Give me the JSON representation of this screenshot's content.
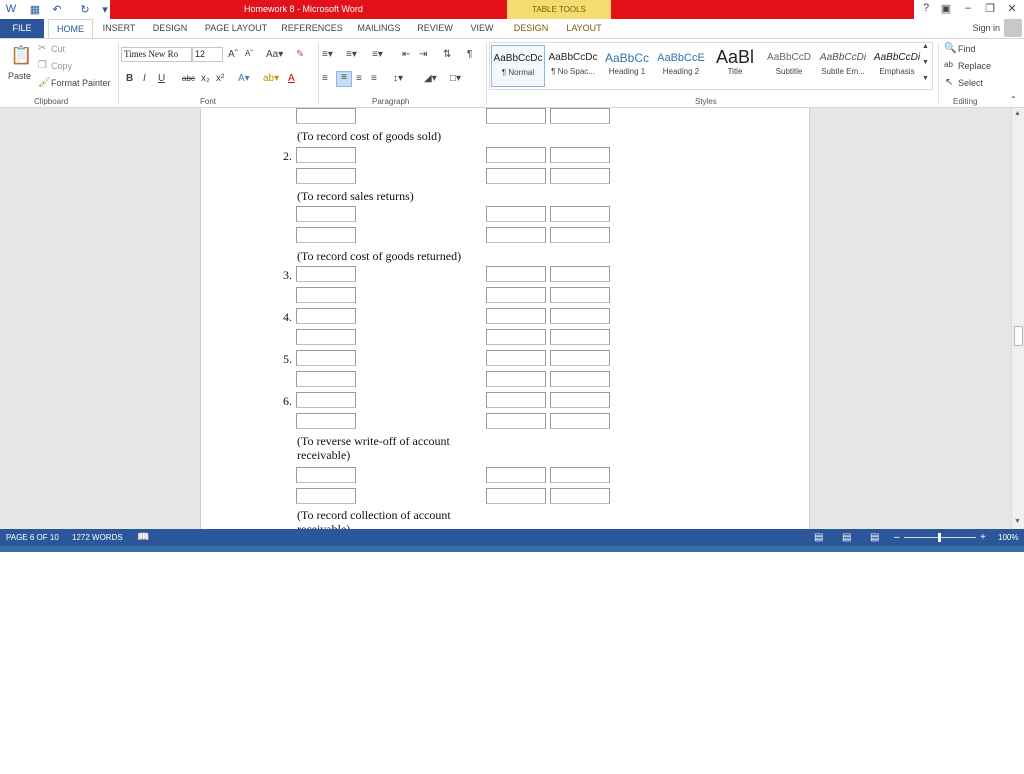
{
  "window": {
    "title": "Homework 8 - Microsoft Word",
    "table_tools": "TABLE TOOLS"
  },
  "tabs": [
    "FILE",
    "HOME",
    "INSERT",
    "DESIGN",
    "PAGE LAYOUT",
    "REFERENCES",
    "MAILINGS",
    "REVIEW",
    "VIEW",
    "DESIGN",
    "LAYOUT"
  ],
  "account": {
    "sign_in": "Sign in"
  },
  "ribbon": {
    "clipboard": {
      "label": "Clipboard",
      "paste": "Paste",
      "cut": "Cut",
      "copy": "Copy",
      "format_painter": "Format Painter"
    },
    "font": {
      "label": "Font",
      "family": "Times New Ro",
      "size": "12"
    },
    "paragraph": {
      "label": "Paragraph"
    },
    "styles": {
      "label": "Styles",
      "items": [
        {
          "preview": "AaBbCcDc",
          "name": "¶ Normal"
        },
        {
          "preview": "AaBbCcDc",
          "name": "¶ No Spac..."
        },
        {
          "preview": "AaBbCc",
          "name": "Heading 1"
        },
        {
          "preview": "AaBbCcE",
          "name": "Heading 2"
        },
        {
          "preview": "AaBl",
          "name": "Title"
        },
        {
          "preview": "AaBbCcD",
          "name": "Subtitle"
        },
        {
          "preview": "AaBbCcDi",
          "name": "Subtle Em..."
        },
        {
          "preview": "AaBbCcDi",
          "name": "Emphasis"
        }
      ]
    },
    "editing": {
      "label": "Editing",
      "find": "Find",
      "replace": "Replace",
      "select": "Select"
    }
  },
  "document": {
    "captions": [
      "(To record cost of goods sold)",
      "(To record sales returns)",
      "(To record cost of goods returned)",
      "(To reverse write-off of account receivable)",
      "(To record collection of account receivable)"
    ],
    "numbers": [
      "2.",
      "3.",
      "4.",
      "5.",
      "6."
    ]
  },
  "status": {
    "page": "PAGE 6 OF 10",
    "words": "1272 WORDS",
    "zoom": "100%"
  }
}
